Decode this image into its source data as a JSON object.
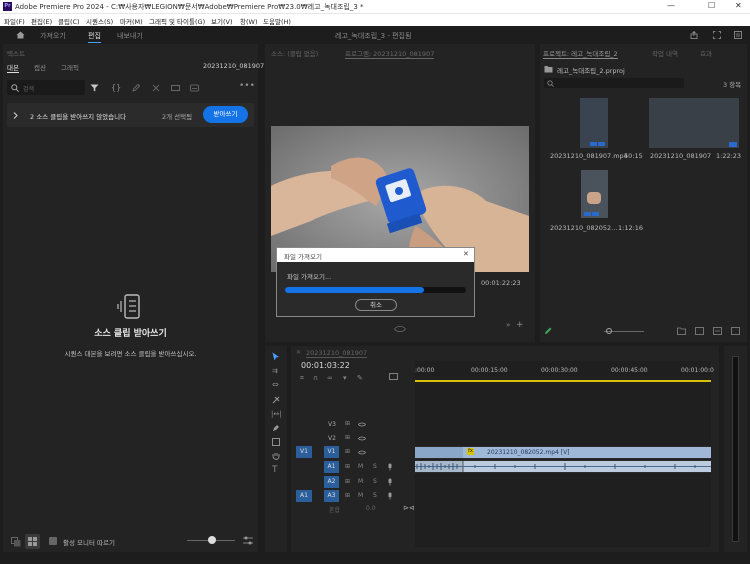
{
  "window": {
    "app_logo": "Pr",
    "title": "Adobe Premiere Pro 2024 - C:₩사용자₩LEGION₩문서₩Adobe₩Premiere Pro₩23.0₩레고_녹대조립_3 *",
    "minimize": "—",
    "maximize": "☐",
    "close": "✕"
  },
  "menu": [
    "파일(F)",
    "편집(E)",
    "클립(C)",
    "시퀀스(S)",
    "마커(M)",
    "그래픽 및 타이틀(G)",
    "보기(V)",
    "창(W)",
    "도움말(H)"
  ],
  "workspace": {
    "tabs": [
      "가져오기",
      "편집",
      "내보내기"
    ],
    "active": "편집",
    "center_title": "레고_녹대조립_3 - 편집됨"
  },
  "text_panel": {
    "title": "텍스트",
    "tabs": [
      "대본",
      "캡션",
      "그래픽"
    ],
    "sequence": "20231210_081907",
    "search_placeholder": "검색",
    "banner_text": "2 소스 클립을 받아쓰지 않았습니다",
    "banner_selected": "2개 선택됨",
    "banner_button": "받아쓰기",
    "empty_title": "소스 클립 받아쓰기",
    "empty_desc": "시퀀스 대본을 보려면 소스 클립을 받아쓰십시오.",
    "follow_monitor": "활성 모니터 따르기"
  },
  "source_tabs": {
    "source": "소스: (클립 없음)",
    "program": "프로그램: 20231210_081907"
  },
  "program": {
    "timecode": "00:01:22:23"
  },
  "import_dialog": {
    "title": "파일 가져오기",
    "message": "파일 가져오기...",
    "progress": 0.77,
    "cancel": "취소",
    "close": "✕"
  },
  "project": {
    "tabs": [
      "프로젝트: 레고_녹대조립_2",
      "작업 내역",
      "효과"
    ],
    "file": "레고_녹대조립_2.prproj",
    "count": "3 항목",
    "items": [
      {
        "name": "20231210_081907.mp4",
        "duration": "50:15"
      },
      {
        "name": "20231210_081907",
        "duration": "1:22:23"
      },
      {
        "name": "20231210_082052...",
        "duration": "1:12:16"
      }
    ]
  },
  "timeline": {
    "sequence": "20231210_081907",
    "timecode": "00:01:03:22",
    "ruler": [
      ":00:00",
      "00:00:15:00",
      "00:00:30:00",
      "00:00:45:00",
      "00:01:00:0"
    ],
    "video_tracks": [
      "V3",
      "V2",
      "V1"
    ],
    "audio_tracks": [
      "A1",
      "A2",
      "A3"
    ],
    "source_v": "V1",
    "source_a": "A1",
    "master": "혼합",
    "master_value": "0.0",
    "clip_v1": "20231210_082052.mp4 [V]",
    "fx": "fx"
  }
}
